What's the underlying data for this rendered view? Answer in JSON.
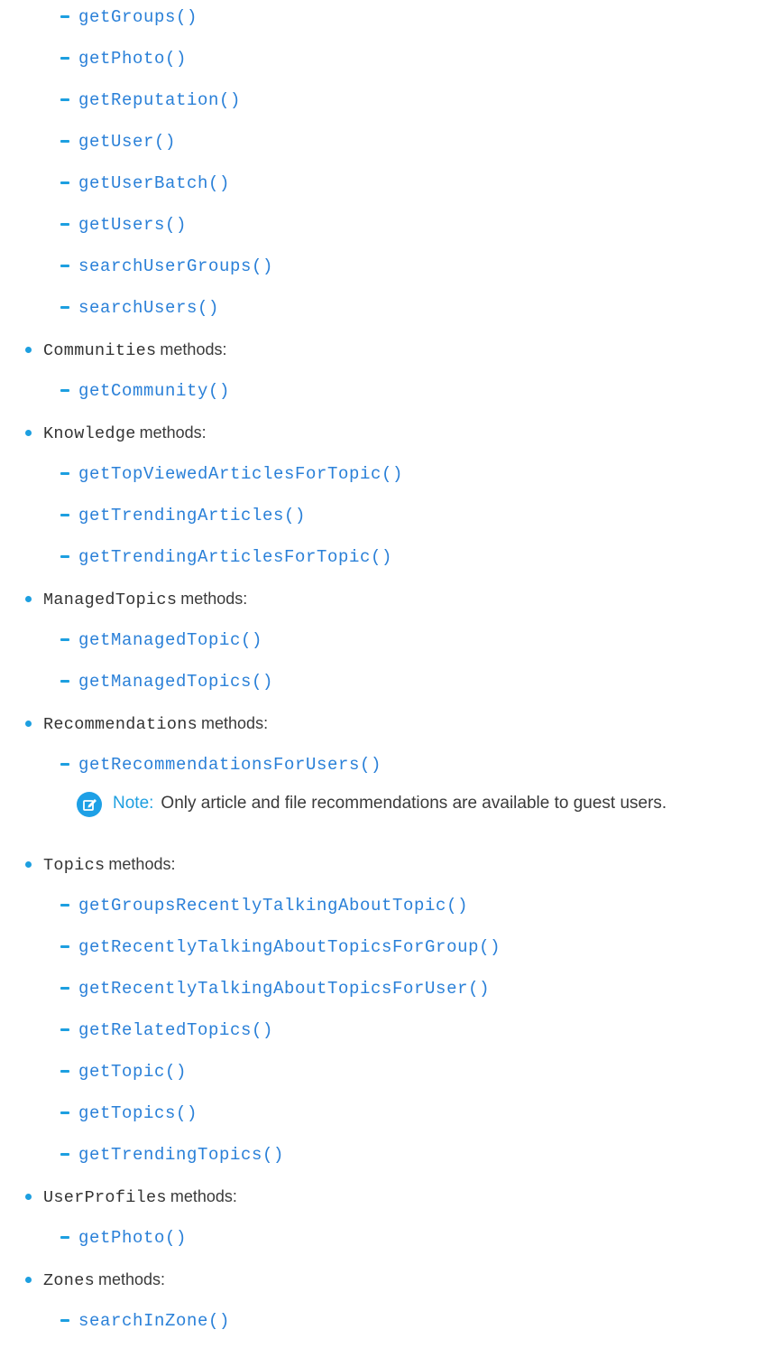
{
  "groups_top": {
    "items": [
      "getGroups()",
      "getPhoto()",
      "getReputation()",
      "getUser()",
      "getUserBatch()",
      "getUsers()",
      "searchUserGroups()",
      "searchUsers()"
    ]
  },
  "communities": {
    "name": "Communities",
    "suffix": "methods:",
    "items": [
      "getCommunity()"
    ]
  },
  "knowledge": {
    "name": "Knowledge",
    "suffix": "methods:",
    "items": [
      "getTopViewedArticlesForTopic()",
      "getTrendingArticles()",
      "getTrendingArticlesForTopic()"
    ]
  },
  "managed_topics": {
    "name": "ManagedTopics",
    "suffix": "methods:",
    "items": [
      "getManagedTopic()",
      "getManagedTopics()"
    ]
  },
  "recommendations": {
    "name": "Recommendations",
    "suffix": "methods:",
    "items": [
      "getRecommendationsForUsers()"
    ],
    "note_label": "Note:",
    "note_text": "Only article and file recommendations are available to guest users."
  },
  "topics": {
    "name": "Topics",
    "suffix": "methods:",
    "items": [
      "getGroupsRecentlyTalkingAboutTopic()",
      "getRecentlyTalkingAboutTopicsForGroup()",
      "getRecentlyTalkingAboutTopicsForUser()",
      "getRelatedTopics()",
      "getTopic()",
      "getTopics()",
      "getTrendingTopics()"
    ]
  },
  "user_profiles": {
    "name": "UserProfiles",
    "suffix": "methods:",
    "items": [
      "getPhoto()"
    ]
  },
  "zones": {
    "name": "Zones",
    "suffix": "methods:",
    "items": [
      "searchInZone()"
    ]
  },
  "colors": {
    "accent": "#1d9fe0",
    "link": "#2a80d8",
    "text": "#3a3a3a"
  },
  "icons": {
    "note": "note-edit-icon"
  }
}
